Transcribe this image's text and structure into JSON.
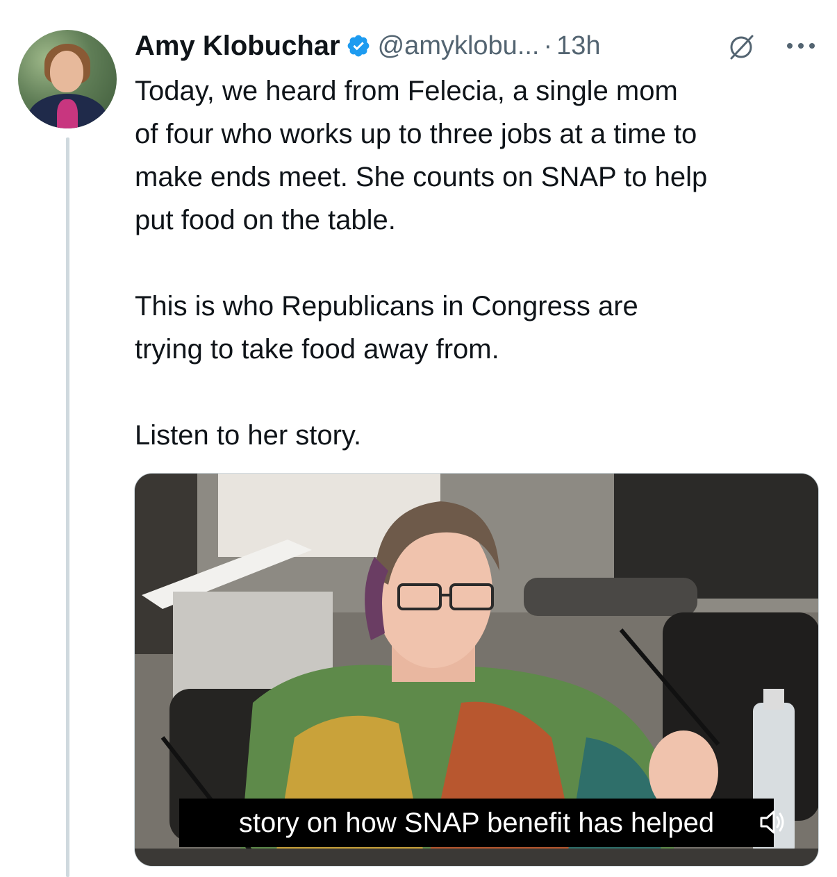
{
  "tweet": {
    "author_name": "Amy Klobuchar",
    "handle": "@amyklobu...",
    "separator": "·",
    "time": "13h",
    "avatar_icon": "profile-photo",
    "verified_icon": "verified-badge-icon",
    "grok_icon": "grok-icon",
    "more_icon": "more-options-icon",
    "text": {
      "paragraph1_line1": "Today, we heard from Felecia, a single mom",
      "paragraph1_line2": "of four who works up to three jobs at a time to",
      "paragraph1_line3": "make ends meet. She counts on SNAP to help",
      "paragraph1_line4": "put food on the table.",
      "paragraph2_line1": "This is who Republicans in Congress are",
      "paragraph2_line2": "trying to take food away from.",
      "paragraph3_line1": "Listen to her story."
    },
    "media": {
      "type": "video",
      "caption": "story on how SNAP benefit has helped",
      "volume_icon": "volume-icon"
    }
  },
  "colors": {
    "text_primary": "#0f1419",
    "text_secondary": "#536471",
    "verified_blue": "#1d9bf0",
    "thread_line": "#cfd9de"
  }
}
